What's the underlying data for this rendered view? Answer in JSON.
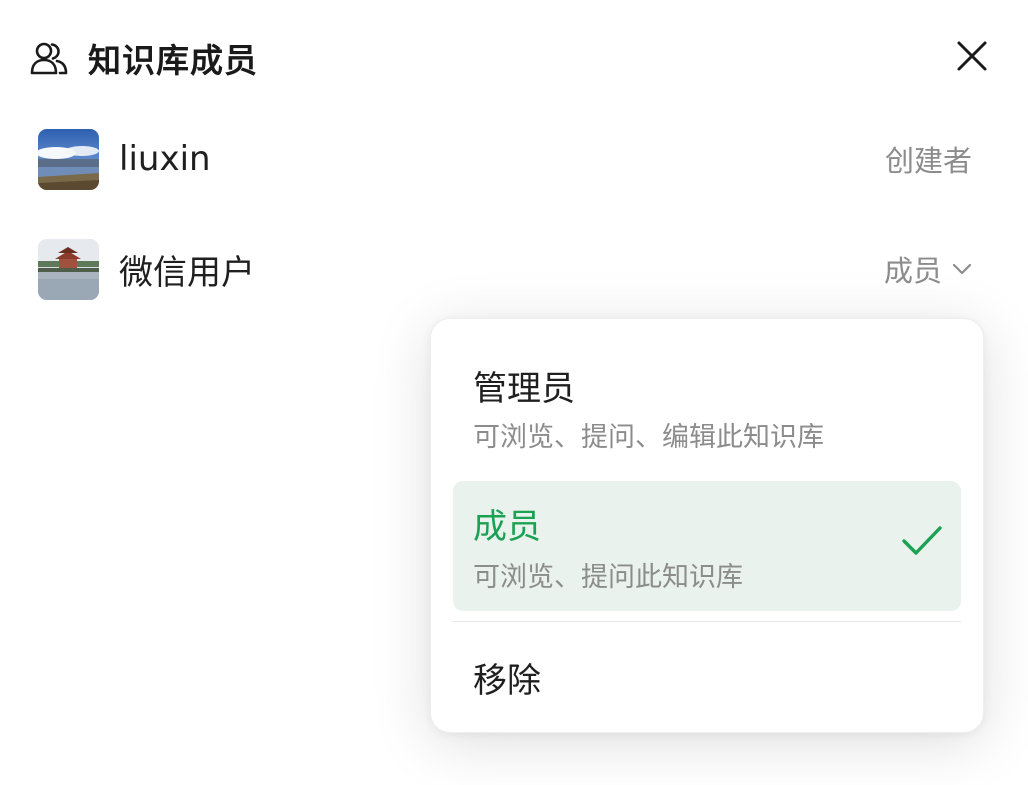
{
  "header": {
    "title": "知识库成员",
    "icon": "people-icon",
    "close_icon": "close-icon"
  },
  "members": [
    {
      "name": "liuxin",
      "role": "创建者",
      "avatar": "landscape-lake-avatar"
    },
    {
      "name": "微信用户",
      "role": "成员",
      "avatar": "pavilion-avatar",
      "dropdown_icon": "chevron-down-icon"
    }
  ],
  "role_menu": {
    "options": [
      {
        "title": "管理员",
        "description": "可浏览、提问、编辑此知识库",
        "selected": false
      },
      {
        "title": "成员",
        "description": "可浏览、提问此知识库",
        "selected": true
      },
      {
        "title": "移除",
        "description": "",
        "selected": false
      }
    ],
    "check_icon": "check-icon"
  },
  "colors": {
    "accent": "#1aa152",
    "selected_bg": "#e9f2ec",
    "secondary_text": "#8c8c8c"
  }
}
